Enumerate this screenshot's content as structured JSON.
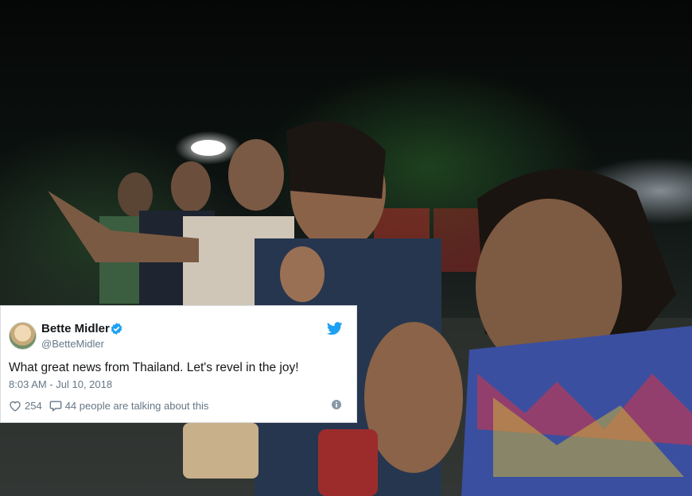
{
  "tweet": {
    "display_name": "Bette Midler",
    "handle": "@BetteMidler",
    "text": "What great news from Thailand.  Let's revel in the joy!",
    "timestamp": "8:03 AM - Jul 10, 2018",
    "likes": "254",
    "talking": "44 people are talking about this",
    "icons": {
      "verified": "verified-badge-icon",
      "brand": "twitter-bird-icon",
      "like": "heart-icon",
      "reply": "speech-bubble-icon",
      "info": "info-icon"
    },
    "colors": {
      "accent": "#1da1f2",
      "text": "#14171a",
      "muted": "#657786"
    }
  }
}
